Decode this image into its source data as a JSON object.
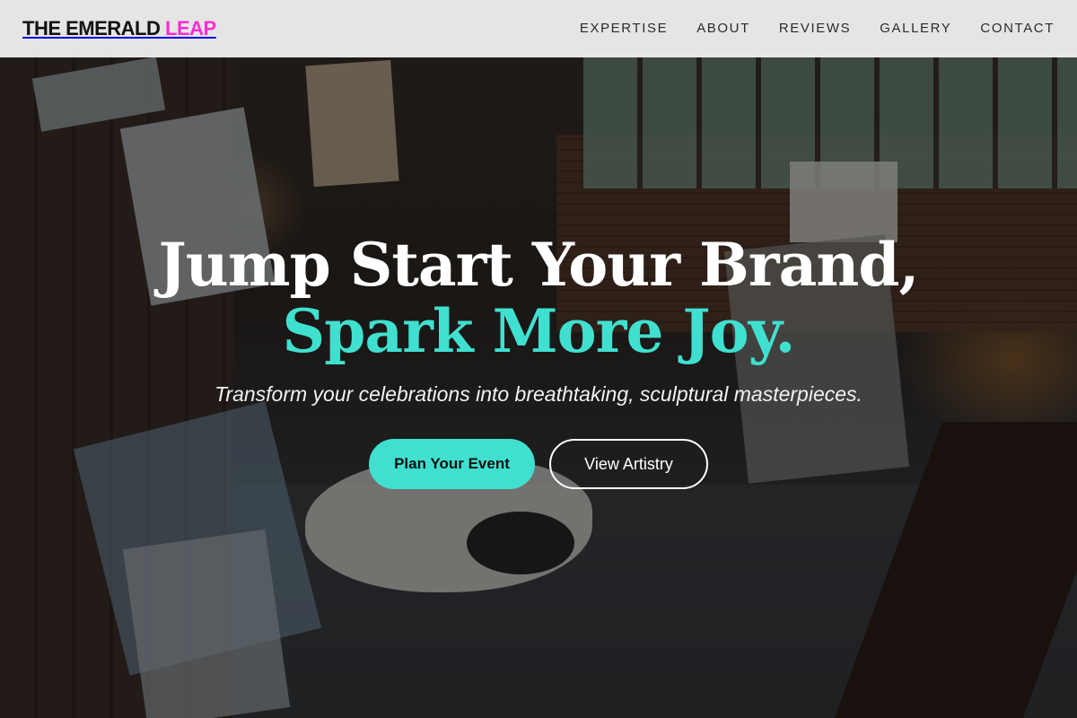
{
  "header": {
    "logo_main": "THE EMERALD",
    "logo_accent": "LEAP",
    "nav": [
      {
        "label": "EXPERTISE"
      },
      {
        "label": "ABOUT"
      },
      {
        "label": "REVIEWS"
      },
      {
        "label": "GALLERY"
      },
      {
        "label": "CONTACT"
      }
    ]
  },
  "hero": {
    "headline_line1": "Jump Start Your Brand,",
    "headline_line2": "Spark More Joy.",
    "subtitle": "Transform your celebrations into breathtaking, sculptural masterpieces.",
    "primary_cta": "Plan Your Event",
    "secondary_cta": "View Artistry"
  },
  "colors": {
    "accent": "#40e0d0",
    "logo_accent": "#ff2bd6",
    "header_bg": "#f6f6f6"
  }
}
